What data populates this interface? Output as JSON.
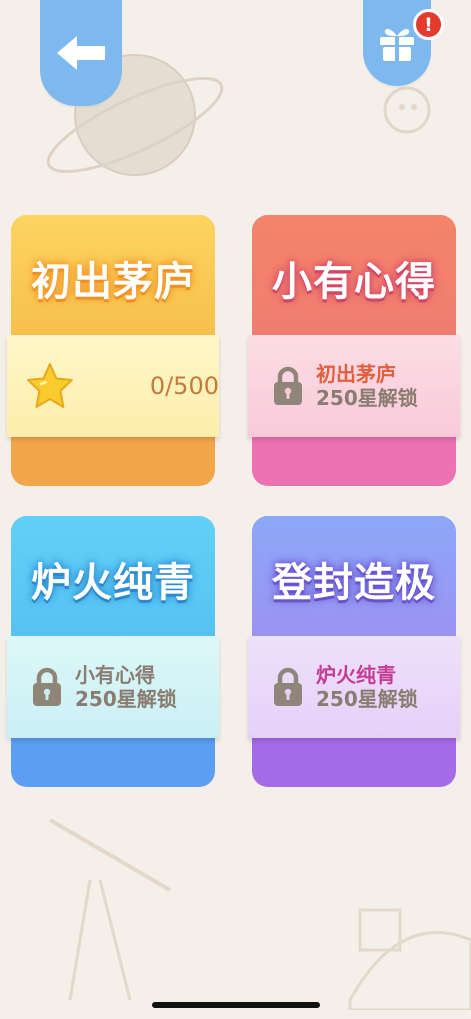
{
  "header": {
    "back_icon": "arrow-left-icon",
    "gift_icon": "gift-icon",
    "notification_badge": "!"
  },
  "levels": [
    {
      "title": "初出茅庐",
      "progress": "0/500",
      "icon": "star-icon"
    },
    {
      "title": "小有心得",
      "unlock_requirement": "初出茅庐",
      "unlock_cost": "250星解锁",
      "icon": "lock-icon"
    },
    {
      "title": "炉火纯青",
      "unlock_requirement": "小有心得",
      "unlock_cost": "250星解锁",
      "icon": "lock-icon"
    },
    {
      "title": "登封造极",
      "unlock_requirement": "炉火纯青",
      "unlock_cost": "250星解锁",
      "icon": "lock-icon"
    }
  ],
  "colors": {
    "background": "#f4efe8",
    "tab_blue": "#7db8ee",
    "badge_red": "#e53b2f"
  }
}
